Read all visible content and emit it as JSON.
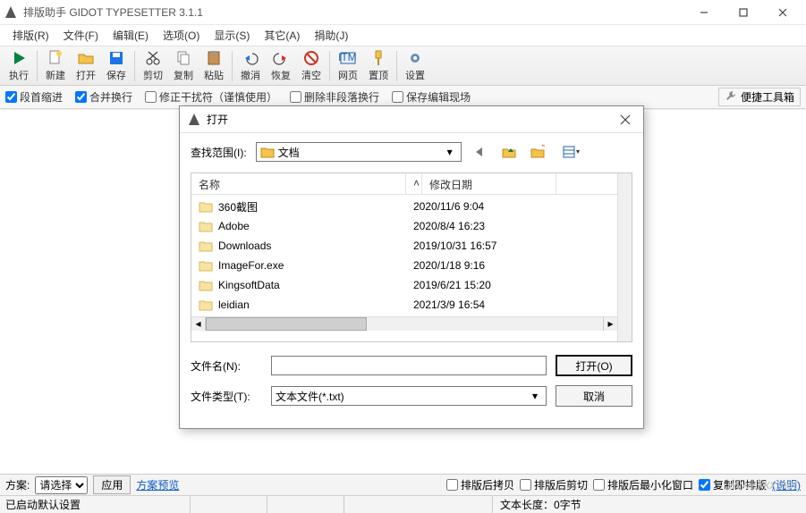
{
  "app": {
    "title": "排版助手 GIDOT TYPESETTER 3.1.1"
  },
  "menu": {
    "items": [
      "排版(R)",
      "文件(F)",
      "编辑(E)",
      "选项(O)",
      "显示(S)",
      "其它(A)",
      "捐助(J)"
    ]
  },
  "toolbar": {
    "run": "执行",
    "new": "新建",
    "open": "打开",
    "save": "保存",
    "cut": "剪切",
    "copy": "复制",
    "paste": "粘贴",
    "undo": "撤消",
    "redo": "恢复",
    "clear": "清空",
    "web": "网页",
    "top": "置顶",
    "settings": "设置"
  },
  "options": {
    "indent": "段首缩进",
    "merge": "合并换行",
    "fixnoise": "修正干扰符（谨慎使用）",
    "delnonpara": "删除非段落换行",
    "keepedit": "保存编辑现场",
    "toolbox": "便捷工具箱"
  },
  "footer": {
    "scheme_label": "方案:",
    "apply": "应用",
    "preview": "方案预览",
    "scheme_options": [
      "请选择"
    ],
    "copy_after": "排版后拷贝",
    "cut_after": "排版后剪切",
    "minimize_after": "排版后最小化窗口",
    "copy_format": "复制即排版",
    "explain": "(说明)"
  },
  "status": {
    "ready": "已启动默认设置",
    "length": "文本长度：0字节"
  },
  "watermark": "www.kkx.net",
  "dialog": {
    "title": "打开",
    "lookin_label": "查找范围(I):",
    "lookin_value": "文档",
    "columns": {
      "name": "名称",
      "date": "修改日期"
    },
    "files": [
      {
        "name": "360截图",
        "date": "2020/11/6 9:04"
      },
      {
        "name": "Adobe",
        "date": "2020/8/4 16:23"
      },
      {
        "name": "Downloads",
        "date": "2019/10/31 16:57"
      },
      {
        "name": "ImageFor.exe",
        "date": "2020/1/18 9:16"
      },
      {
        "name": "KingsoftData",
        "date": "2019/6/21 15:20"
      },
      {
        "name": "leidian",
        "date": "2021/3/9 16:54"
      }
    ],
    "filename_label": "文件名(N):",
    "filename_value": "",
    "filetype_label": "文件类型(T):",
    "filetype_value": "文本文件(*.txt)",
    "open_btn": "打开(O)",
    "cancel_btn": "取消"
  }
}
